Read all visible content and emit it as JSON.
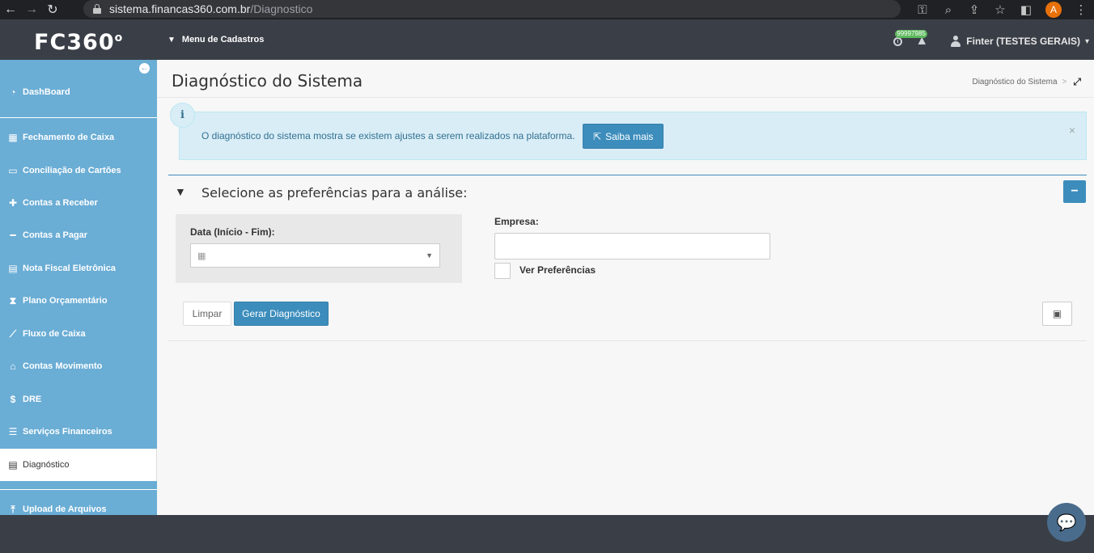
{
  "browser": {
    "url_host": "sistema.financas360.com.br",
    "url_path": "/Diagnostico",
    "profile_initial": "A"
  },
  "header": {
    "logo_text": "FC360",
    "logo_sup": "o",
    "menu_label": "Menu de Cadastros",
    "notification_count": "99997985",
    "user_name": "Finter (TESTES GERAIS)"
  },
  "sidebar": {
    "items": [
      {
        "label": "DashBoard",
        "icon": "dashboard-icon",
        "glyph": "◔"
      },
      {
        "label": "Fechamento de Caixa",
        "icon": "calendar-icon",
        "glyph": "▦"
      },
      {
        "label": "Conciliação de Cartões",
        "icon": "credit-card-icon",
        "glyph": "▭"
      },
      {
        "label": "Contas a Receber",
        "icon": "plus-icon",
        "glyph": "✚"
      },
      {
        "label": "Contas a Pagar",
        "icon": "minus-icon",
        "glyph": "━"
      },
      {
        "label": "Nota Fiscal Eletrônica",
        "icon": "building-icon",
        "glyph": "▤"
      },
      {
        "label": "Plano Orçamentário",
        "icon": "hourglass-icon",
        "glyph": "⧗"
      },
      {
        "label": "Fluxo de Caixa",
        "icon": "line-chart-icon",
        "glyph": "⟋"
      },
      {
        "label": "Contas Movimento",
        "icon": "bank-icon",
        "glyph": "⌂"
      },
      {
        "label": "DRE",
        "icon": "dollar-icon",
        "glyph": "$"
      },
      {
        "label": "Serviços Financeiros",
        "icon": "list-icon",
        "glyph": "☰"
      },
      {
        "label": "Diagnóstico",
        "icon": "file-icon",
        "glyph": "▤"
      },
      {
        "label": "Upload de Arquivos",
        "icon": "upload-icon",
        "glyph": "⤒"
      }
    ]
  },
  "page": {
    "title": "Diagnóstico do Sistema",
    "breadcrumb_current": "Diagnóstico do Sistema",
    "breadcrumb_sep": ">"
  },
  "info": {
    "icon_glyph": "i",
    "text": "O diagnóstico do sistema mostra se existem ajustes a serem realizados na plataforma.",
    "button_label": "Saiba mais",
    "close_glyph": "×"
  },
  "filter": {
    "title": "Selecione as preferências para a análise:",
    "date_label": "Data (Início - Fim):",
    "date_value": "",
    "empresa_label": "Empresa:",
    "empresa_value": "",
    "ver_preferencias_label": "Ver Preferências",
    "limpar_label": "Limpar",
    "gerar_label": "Gerar Diagnóstico"
  },
  "colors": {
    "sidebar_bg": "#6aadd5",
    "header_bg": "#3a3f47",
    "primary_button": "#3c8dbc",
    "info_bg": "#d9edf7"
  }
}
